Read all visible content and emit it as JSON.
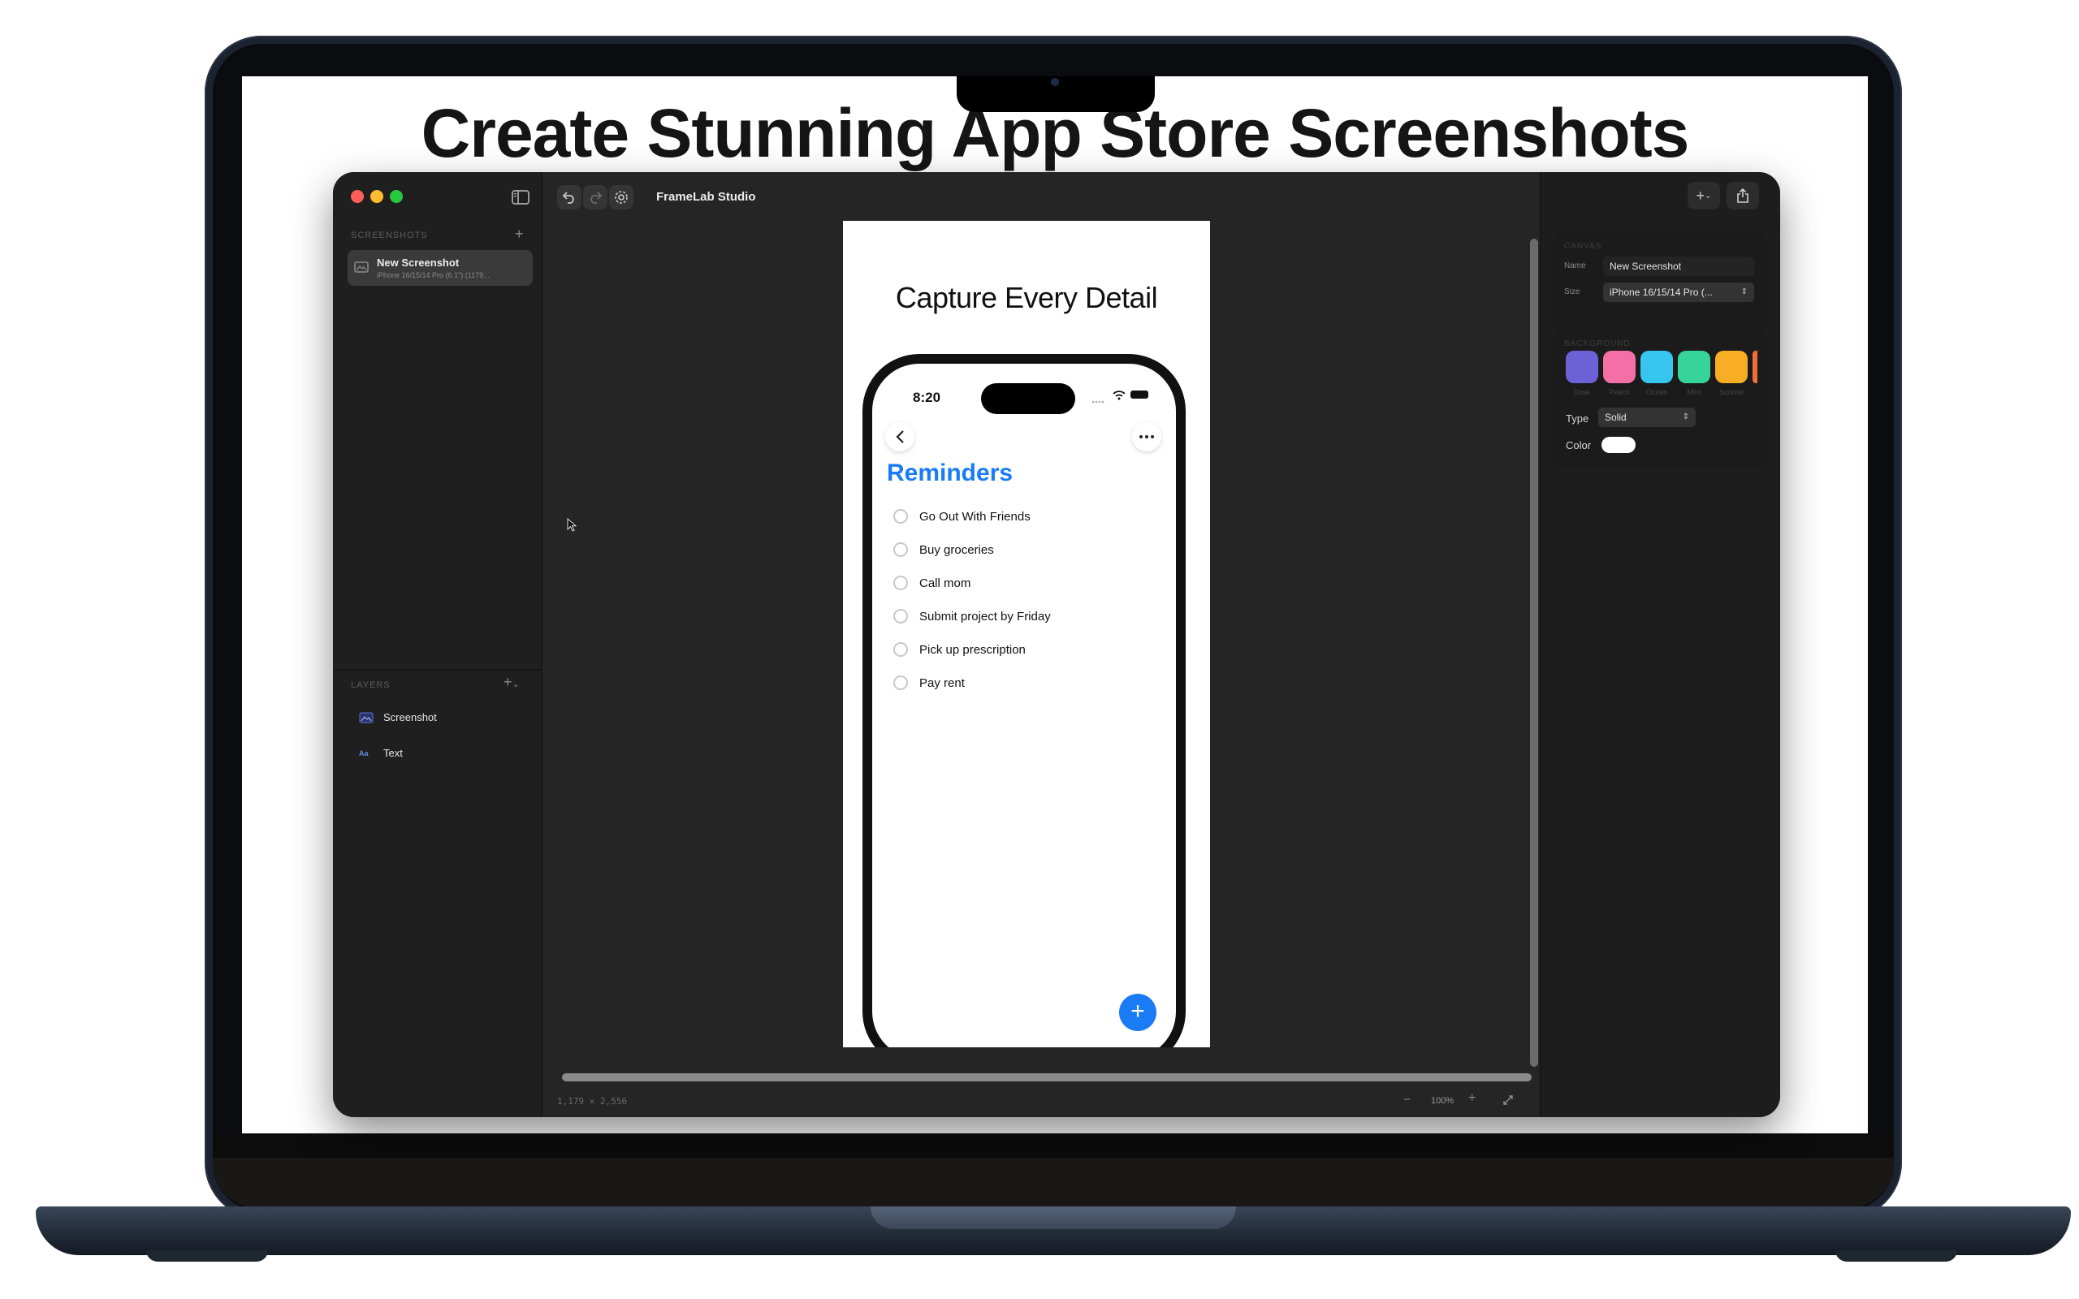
{
  "headline": "Create Stunning App Store Screenshots",
  "window": {
    "title": "FrameLab Studio",
    "traffic_lights": {
      "close": "#ff5f57",
      "minimize": "#febc2e",
      "maximize": "#28c840"
    }
  },
  "sidebar": {
    "screenshots_header": "SCREENSHOTS",
    "add_symbol": "+",
    "selected_item": {
      "title": "New Screenshot",
      "subtitle": "iPhone 16/15/14 Pro (6.1\") (1179..."
    },
    "layers_header": "LAYERS",
    "layers": [
      {
        "label": "Screenshot",
        "icon": "image-icon"
      },
      {
        "label": "Text",
        "icon": "text-icon",
        "icon_text": "Aa"
      }
    ]
  },
  "canvas": {
    "caption": "Capture Every Detail",
    "dimensions": "1,179 × 2,556",
    "zoom": "100%",
    "zoom_out": "−",
    "zoom_in": "+"
  },
  "phone": {
    "time": "8:20",
    "title": "Reminders",
    "title_color": "#1a7cf5",
    "reminders": [
      "Go Out With Friends",
      "Buy groceries",
      "Call mom",
      "Submit project by Friday",
      "Pick up prescription",
      "Pay rent"
    ],
    "fab_color": "#1a7cf5",
    "fab_symbol": "+"
  },
  "inspector": {
    "canvas_header": "CANVAS",
    "name_label": "Name",
    "name_value": "New Screenshot",
    "size_label": "Size",
    "size_value": "iPhone 16/15/14 Pro (...",
    "background_header": "BACKGROUND",
    "swatches": [
      {
        "label": "Dusk",
        "color": "#6c61d6"
      },
      {
        "label": "Peach",
        "color": "#f36fa5"
      },
      {
        "label": "Ocean",
        "color": "#36c5ef"
      },
      {
        "label": "Mint",
        "color": "#36d49a"
      },
      {
        "label": "Sunrise",
        "color": "#f7ae25"
      }
    ],
    "type_label": "Type",
    "type_value": "Solid",
    "color_label": "Color",
    "color_value": "#ffffff"
  }
}
